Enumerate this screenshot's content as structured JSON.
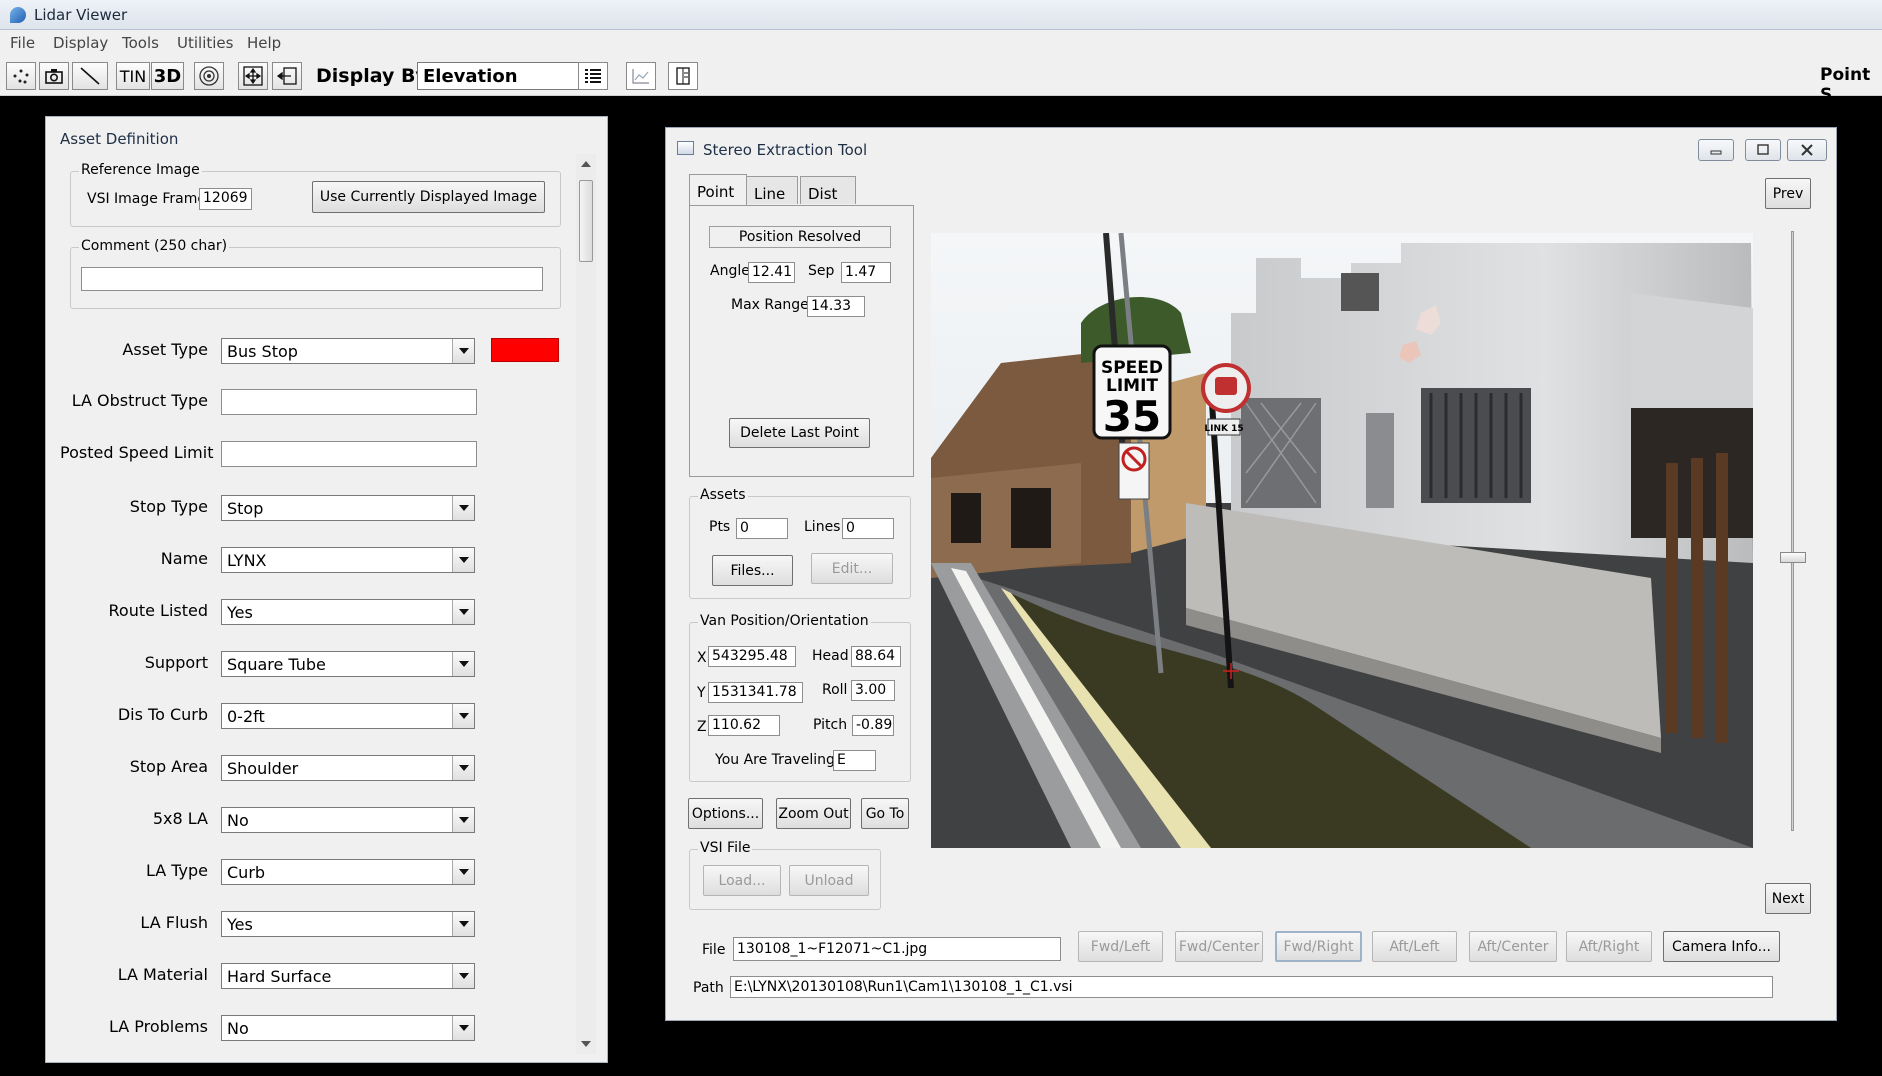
{
  "window": {
    "title": "Lidar Viewer",
    "point_label": "Point S"
  },
  "menu": [
    "File",
    "Display",
    "Tools",
    "Utilities",
    "Help"
  ],
  "toolbar": {
    "tin": "TIN",
    "three_d": "3D",
    "display_by_label": "Display By",
    "display_by_value": "Elevation"
  },
  "asset_panel": {
    "title": "Asset Definition",
    "reference_group": "Reference Image",
    "vsi_frame_label": "VSI Image Frame",
    "vsi_frame_value": "12069",
    "use_current_button": "Use Currently Displayed Image",
    "comment_label": "Comment (250 char)",
    "comment_value": "",
    "asset_type_label": "Asset Type",
    "asset_type_value": "Bus Stop",
    "asset_color": "#ff0000",
    "fields": [
      {
        "label": "LA Obstruct Type",
        "value": "",
        "kind": "text"
      },
      {
        "label": "Posted Speed Limit",
        "value": "",
        "kind": "text"
      },
      {
        "label": "Stop Type",
        "value": "Stop",
        "kind": "combo"
      },
      {
        "label": "Name",
        "value": "LYNX",
        "kind": "combo"
      },
      {
        "label": "Route Listed",
        "value": "Yes",
        "kind": "combo"
      },
      {
        "label": "Support",
        "value": "Square Tube",
        "kind": "combo"
      },
      {
        "label": "Dis To Curb",
        "value": "0-2ft",
        "kind": "combo"
      },
      {
        "label": "Stop Area",
        "value": "Shoulder",
        "kind": "combo"
      },
      {
        "label": "5x8 LA",
        "value": "No",
        "kind": "combo"
      },
      {
        "label": "LA Type",
        "value": "Curb",
        "kind": "combo"
      },
      {
        "label": "LA Flush",
        "value": "Yes",
        "kind": "combo"
      },
      {
        "label": "LA Material",
        "value": "Hard Surface",
        "kind": "combo"
      },
      {
        "label": "LA Problems",
        "value": "No",
        "kind": "combo"
      }
    ]
  },
  "stereo": {
    "title": "Stereo Extraction Tool",
    "tabs": [
      "Point",
      "Line",
      "Dist"
    ],
    "status": "Position Resolved",
    "angle_label": "Angle",
    "angle_value": "12.41",
    "sep_label": "Sep",
    "sep_value": "1.47",
    "max_range_label": "Max Range",
    "max_range_value": "14.33",
    "delete_last_point": "Delete Last Point",
    "assets_group": "Assets",
    "pts_label": "Pts",
    "pts_value": "0",
    "lines_label": "Lines",
    "lines_value": "0",
    "files_button": "Files...",
    "edit_button": "Edit...",
    "van_group": "Van Position/Orientation",
    "x_label": "X",
    "x_value": "543295.48",
    "y_label": "Y",
    "y_value": "1531341.78",
    "z_label": "Z",
    "z_value": "110.62",
    "head_label": "Head",
    "head_value": "88.64",
    "roll_label": "Roll",
    "roll_value": "3.00",
    "pitch_label": "Pitch",
    "pitch_value": "-0.89",
    "traveling_label": "You Are Traveling",
    "traveling_value": "E",
    "options_button": "Options...",
    "zoom_out_button": "Zoom Out",
    "go_to_button": "Go To",
    "vsi_group": "VSI File",
    "load_button": "Load...",
    "unload_button": "Unload",
    "prev_button": "Prev",
    "next_button": "Next",
    "file_label": "File",
    "file_value": "130108_1~F12071~C1.jpg",
    "path_label": "Path",
    "path_value": "E:\\LYNX\\20130108\\Run1\\Cam1\\130108_1_C1.vsi",
    "camera_buttons": [
      "Fwd/Left",
      "Fwd/Center",
      "Fwd/Right",
      "Aft/Left",
      "Aft/Center",
      "Aft/Right"
    ],
    "camera_info_button": "Camera Info...",
    "sign_text": {
      "line1": "SPEED",
      "line2": "LIMIT",
      "number": "35",
      "link": "LINK 15"
    }
  }
}
